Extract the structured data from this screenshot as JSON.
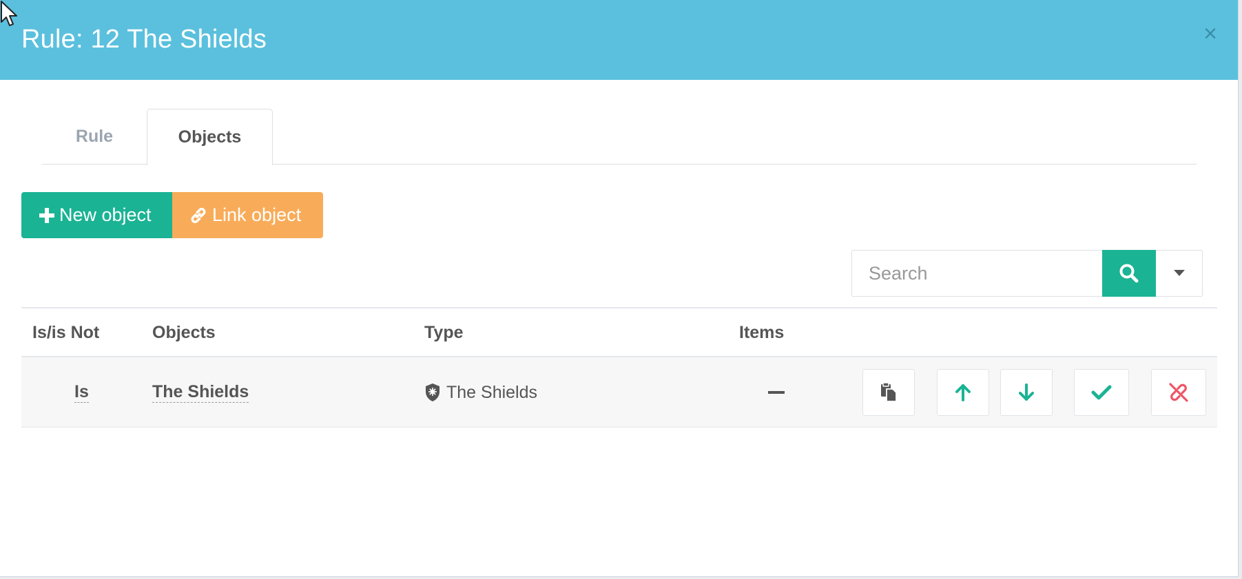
{
  "modal": {
    "title": "Rule: 12 The Shields",
    "close_label": "×"
  },
  "tabs": [
    {
      "label": "Rule",
      "active": false
    },
    {
      "label": "Objects",
      "active": true
    }
  ],
  "toolbar": {
    "new_object_label": "New object",
    "link_object_label": "Link object"
  },
  "search": {
    "placeholder": "Search",
    "value": ""
  },
  "table": {
    "headers": [
      "Is/is Not",
      "Objects",
      "Type",
      "Items"
    ],
    "rows": [
      {
        "is_not": "Is",
        "object": "The Shields",
        "type": "The Shields",
        "items": "—"
      }
    ]
  },
  "colors": {
    "header": "#5bc0de",
    "primary": "#1ab394",
    "warning": "#f8ac59",
    "danger": "#ed5565"
  },
  "icons": {
    "type_icon": "shield-icon",
    "actions": [
      "copy-icon",
      "arrow-up-icon",
      "arrow-down-icon",
      "check-icon",
      "unlink-icon"
    ]
  }
}
